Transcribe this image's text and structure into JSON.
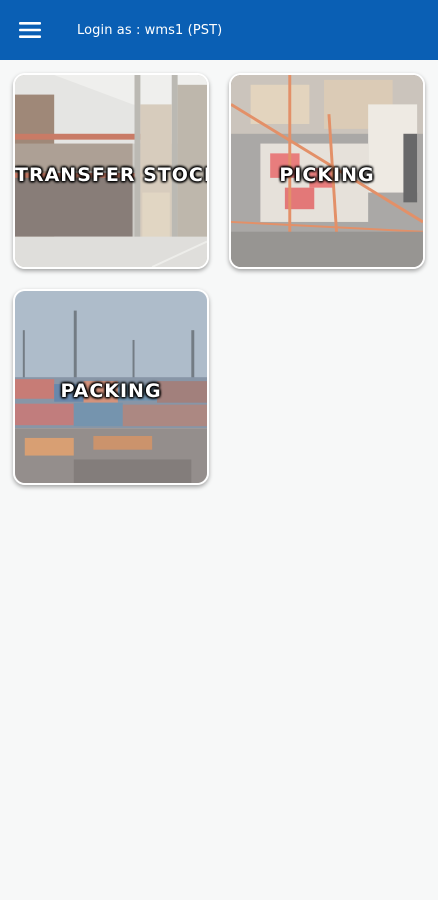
{
  "header": {
    "login_text": "Login as : wms1 (PST)",
    "menu_icon": "hamburger-menu-icon",
    "bar_color": "#0a5fb4"
  },
  "tiles": [
    {
      "label": "TRANSFER STOCK",
      "image": "warehouse-shelves-image"
    },
    {
      "label": "PICKING",
      "image": "warehouse-picking-image"
    },
    {
      "label": "PACKING",
      "image": "container-port-image"
    }
  ]
}
